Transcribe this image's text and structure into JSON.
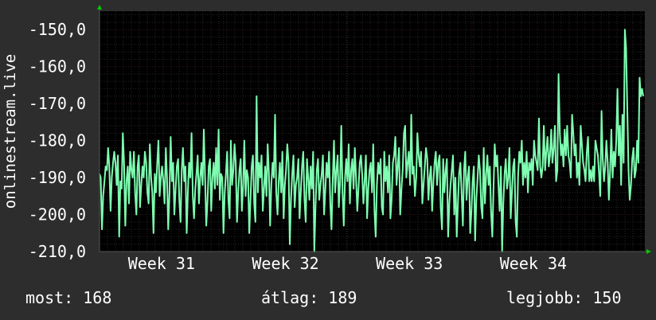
{
  "chart_data": {
    "type": "line",
    "ylabel": "onlinestream.live",
    "y_range": [
      -210,
      -145
    ],
    "y_ticks": [
      -150,
      -160,
      -170,
      -180,
      -190,
      -200,
      -210
    ],
    "y_tick_labels": [
      "-150,0",
      "-160,0",
      "-170,0",
      "-180,0",
      "-190,0",
      "-200,0",
      "-210,0"
    ],
    "x_range": [
      0,
      4.4
    ],
    "x_ticks": [
      {
        "label": "Week 31",
        "x": 0.5
      },
      {
        "label": "Week 32",
        "x": 1.5
      },
      {
        "label": "Week 33",
        "x": 2.5
      },
      {
        "label": "Week 34",
        "x": 3.5
      }
    ],
    "grid": true,
    "colors": {
      "background": "#2d2d2d",
      "plot_area": "#000000",
      "line": "#7fffb2",
      "grid_major": "#3a1818",
      "grid_minor": "#262626",
      "axis_arrow": "#00cc00"
    },
    "series": [
      {
        "values": [
          -189,
          -190,
          -204,
          -195,
          -191,
          -187,
          -188,
          -182,
          -187,
          -199,
          -190,
          -186,
          -183,
          -186,
          -192,
          -184,
          -206,
          -191,
          -193,
          -178,
          -186,
          -203,
          -191,
          -187,
          -197,
          -183,
          -188,
          -190,
          -183,
          -194,
          -200,
          -187,
          -184,
          -198,
          -192,
          -187,
          -190,
          -183,
          -186,
          -194,
          -197,
          -181,
          -190,
          -194,
          -205,
          -189,
          -194,
          -186,
          -180,
          -195,
          -190,
          -187,
          -191,
          -197,
          -182,
          -190,
          -204,
          -194,
          -179,
          -191,
          -186,
          -200,
          -193,
          -187,
          -185,
          -196,
          -202,
          -188,
          -182,
          -191,
          -187,
          -205,
          -194,
          -186,
          -190,
          -178,
          -195,
          -201,
          -193,
          -189,
          -184,
          -197,
          -190,
          -186,
          -192,
          -177,
          -190,
          -203,
          -196,
          -187,
          -185,
          -199,
          -190,
          -186,
          -193,
          -182,
          -192,
          -177,
          -196,
          -189,
          -190,
          -205,
          -194,
          -189,
          -183,
          -196,
          -201,
          -180,
          -192,
          -188,
          -181,
          -186,
          -202,
          -194,
          -188,
          -185,
          -199,
          -192,
          -180,
          -195,
          -188,
          -190,
          -205,
          -196,
          -187,
          -184,
          -197,
          -202,
          -168,
          -194,
          -186,
          -190,
          -184,
          -199,
          -193,
          -187,
          -195,
          -181,
          -189,
          -203,
          -192,
          -186,
          -190,
          -173,
          -194,
          -200,
          -191,
          -186,
          -194,
          -183,
          -201,
          -192,
          -188,
          -181,
          -186,
          -208,
          -196,
          -189,
          -184,
          -198,
          -192,
          -190,
          -185,
          -201,
          -194,
          -187,
          -183,
          -196,
          -202,
          -185,
          -190,
          -196,
          -187,
          -193,
          -183,
          -210,
          -198,
          -188,
          -185,
          -196,
          -192,
          -189,
          -184,
          -200,
          -193,
          -186,
          -190,
          -183,
          -197,
          -204,
          -191,
          -180,
          -194,
          -188,
          -184,
          -198,
          -191,
          -176,
          -194,
          -203,
          -190,
          -185,
          -191,
          -181,
          -197,
          -188,
          -185,
          -193,
          -182,
          -190,
          -199,
          -193,
          -186,
          -184,
          -189,
          -197,
          -191,
          -184,
          -201,
          -193,
          -188,
          -186,
          -194,
          -181,
          -199,
          -206,
          -192,
          -186,
          -189,
          -185,
          -198,
          -200,
          -183,
          -191,
          -187,
          -194,
          -184,
          -201,
          -196,
          -186,
          -184,
          -179,
          -192,
          -187,
          -182,
          -200,
          -193,
          -188,
          -178,
          -176,
          -190,
          -186,
          -183,
          -192,
          -173,
          -189,
          -187,
          -195,
          -190,
          -178,
          -184,
          -187,
          -183,
          -197,
          -192,
          -187,
          -182,
          -185,
          -196,
          -190,
          -187,
          -199,
          -191,
          -186,
          -183,
          -192,
          -186,
          -184,
          -198,
          -204,
          -185,
          -194,
          -188,
          -185,
          -206,
          -197,
          -192,
          -188,
          -184,
          -200,
          -190,
          -206,
          -197,
          -189,
          -186,
          -194,
          -203,
          -188,
          -183,
          -196,
          -190,
          -187,
          -205,
          -199,
          -191,
          -187,
          -207,
          -196,
          -190,
          -184,
          -188,
          -198,
          -201,
          -182,
          -197,
          -189,
          -184,
          -192,
          -187,
          -199,
          -206,
          -193,
          -181,
          -187,
          -184,
          -192,
          -199,
          -187,
          -210,
          -197,
          -189,
          -185,
          -193,
          -190,
          -182,
          -201,
          -194,
          -187,
          -185,
          -202,
          -206,
          -190,
          -183,
          -186,
          -180,
          -192,
          -186,
          -190,
          -183,
          -194,
          -186,
          -188,
          -185,
          -192,
          -180,
          -184,
          -186,
          -188,
          -174,
          -187,
          -190,
          -187,
          -176,
          -188,
          -183,
          -179,
          -187,
          -184,
          -177,
          -186,
          -182,
          -176,
          -191,
          -188,
          -162,
          -178,
          -184,
          -181,
          -187,
          -177,
          -184,
          -176,
          -184,
          -186,
          -190,
          -173,
          -178,
          -184,
          -181,
          -190,
          -186,
          -192,
          -176,
          -181,
          -186,
          -188,
          -191,
          -183,
          -179,
          -191,
          -188,
          -191,
          -187,
          -191,
          -180,
          -182,
          -184,
          -189,
          -195,
          -172,
          -185,
          -191,
          -187,
          -180,
          -186,
          -196,
          -188,
          -177,
          -190,
          -183,
          -187,
          -180,
          -166,
          -184,
          -176,
          -192,
          -173,
          -186,
          -150,
          -155,
          -172,
          -188,
          -196,
          -192,
          -185,
          -182,
          -190,
          -188,
          -180,
          -186,
          -163,
          -168,
          -166,
          -168
        ]
      }
    ]
  },
  "stats": {
    "current": "most: 168",
    "average": "átlag: 189",
    "best": "legjobb: 150"
  }
}
